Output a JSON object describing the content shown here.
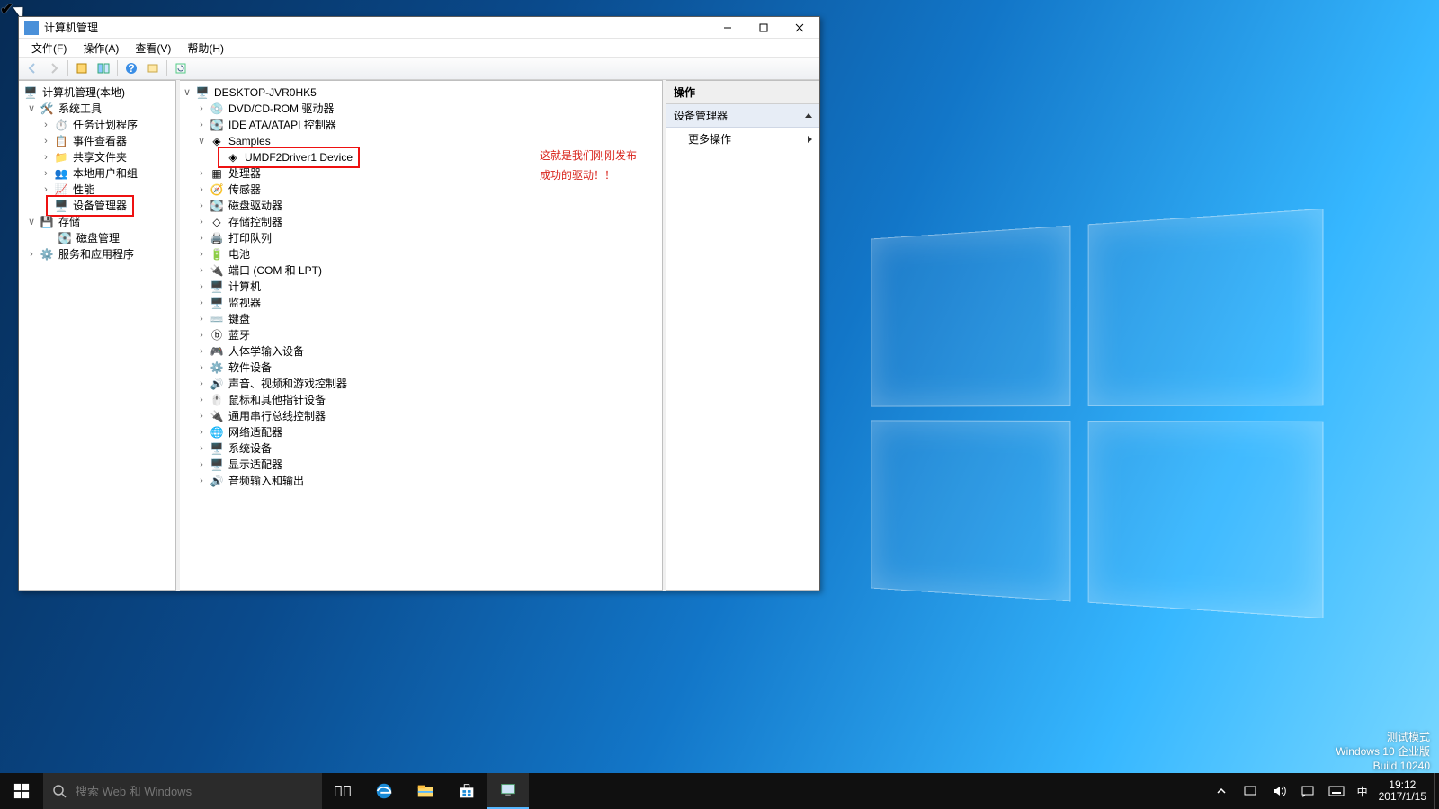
{
  "window": {
    "title": "计算机管理",
    "menus": [
      "文件(F)",
      "操作(A)",
      "查看(V)",
      "帮助(H)"
    ]
  },
  "left_tree": {
    "root": "计算机管理(本地)",
    "systools": "系统工具",
    "systools_children": [
      "任务计划程序",
      "事件查看器",
      "共享文件夹",
      "本地用户和组",
      "性能",
      "设备管理器"
    ],
    "storage": "存储",
    "storage_children": [
      "磁盘管理"
    ],
    "services": "服务和应用程序"
  },
  "device_tree": {
    "root": "DESKTOP-JVR0HK5",
    "categories": [
      "DVD/CD-ROM 驱动器",
      "IDE ATA/ATAPI 控制器",
      "Samples",
      "处理器",
      "传感器",
      "磁盘驱动器",
      "存储控制器",
      "打印队列",
      "电池",
      "端口 (COM 和 LPT)",
      "计算机",
      "监视器",
      "键盘",
      "蓝牙",
      "人体学输入设备",
      "软件设备",
      "声音、视频和游戏控制器",
      "鼠标和其他指针设备",
      "通用串行总线控制器",
      "网络适配器",
      "系统设备",
      "显示适配器",
      "音频输入和输出"
    ],
    "samples_expanded_item": "UMDF2Driver1 Device"
  },
  "annotation": {
    "line1": "这就是我们刚刚发布",
    "line2": "成功的驱动！！"
  },
  "actions": {
    "header": "操作",
    "group": "设备管理器",
    "more": "更多操作"
  },
  "watermark": {
    "l1": "测试模式",
    "l2": "Windows 10 企业版",
    "l3": "Build 10240"
  },
  "taskbar": {
    "search_placeholder": "搜索 Web 和 Windows",
    "ime": "中",
    "time": "19:12",
    "date": "2017/1/15"
  }
}
